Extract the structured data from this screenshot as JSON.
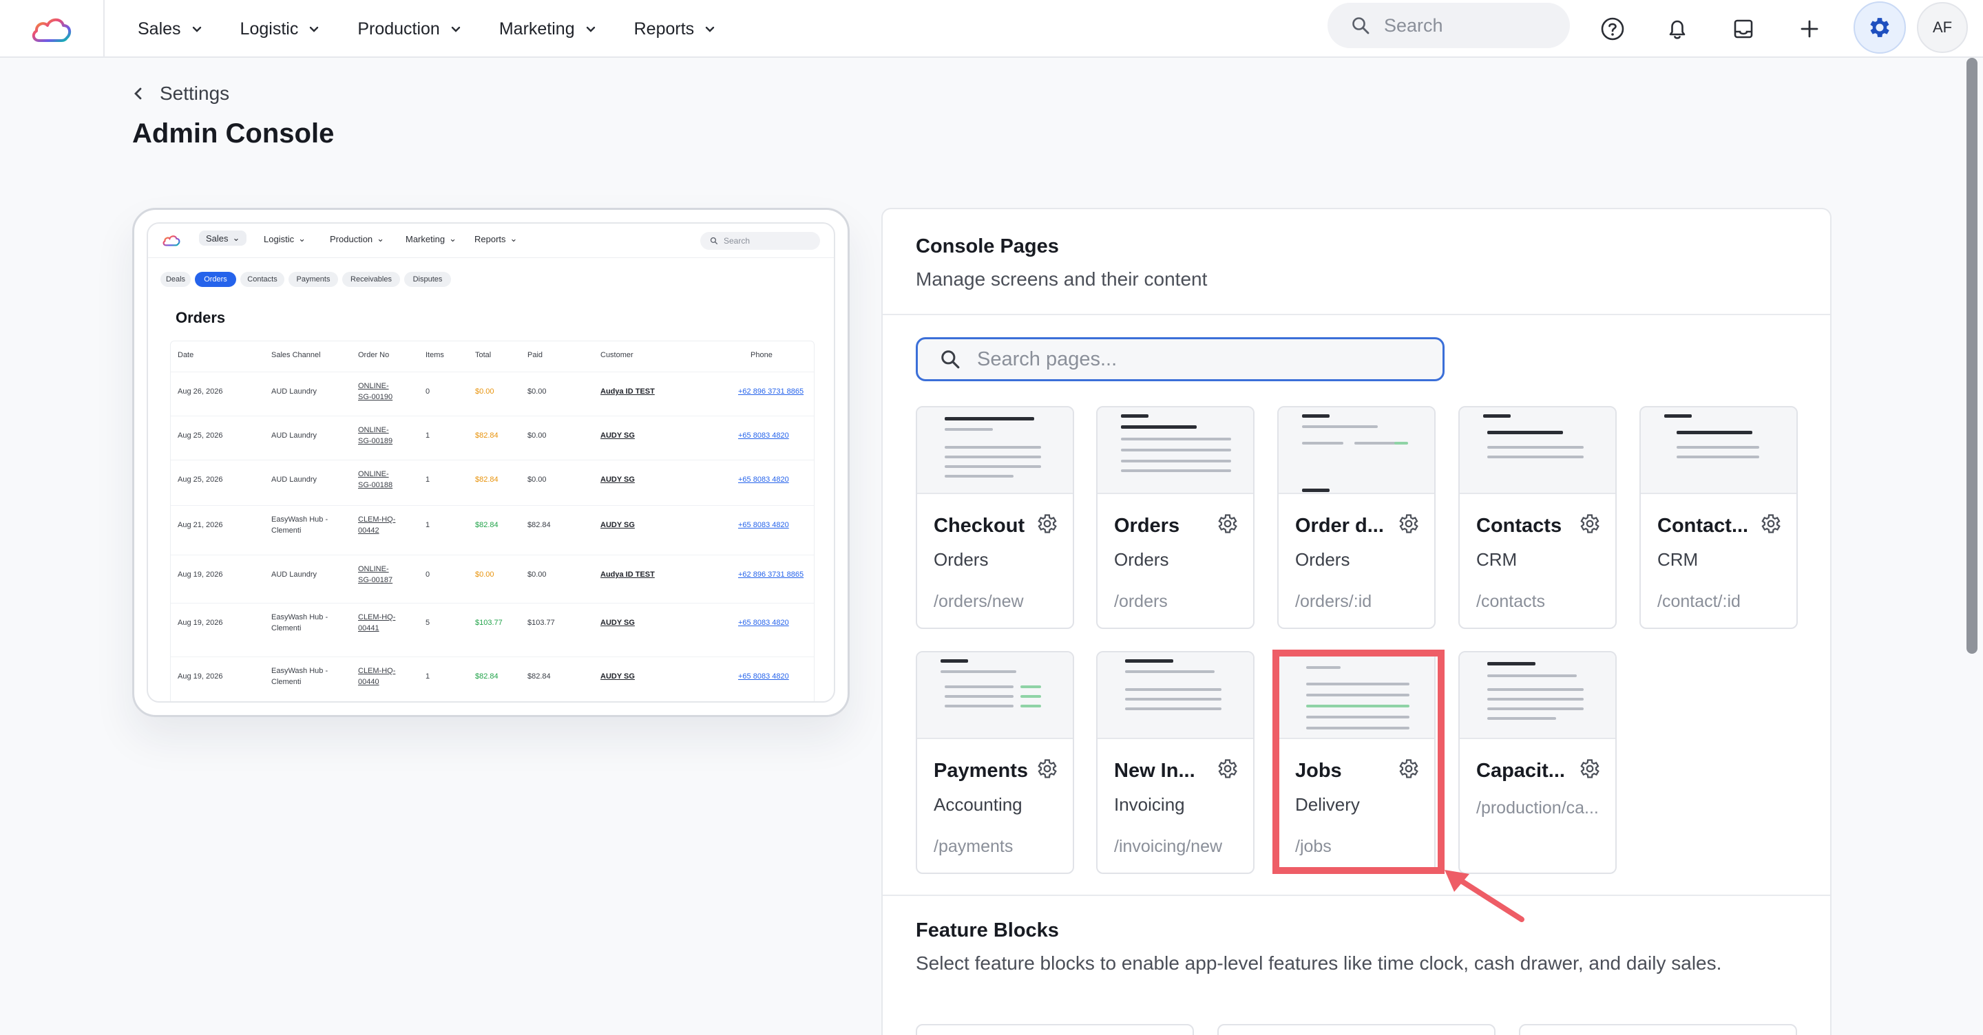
{
  "nav": {
    "menu": [
      {
        "label": "Sales"
      },
      {
        "label": "Logistic"
      },
      {
        "label": "Production"
      },
      {
        "label": "Marketing"
      },
      {
        "label": "Reports"
      }
    ],
    "search_placeholder": "Search",
    "avatar_initials": "AF"
  },
  "header": {
    "back_label": "Settings",
    "title": "Admin Console"
  },
  "preview": {
    "nav": [
      "Sales",
      "Logistic",
      "Production",
      "Marketing",
      "Reports"
    ],
    "search": "Search",
    "chips": [
      "Deals",
      "Orders",
      "Contacts",
      "Payments",
      "Receivables",
      "Disputes"
    ],
    "active_chip": "Orders",
    "title": "Orders",
    "columns": [
      "Date",
      "Sales Channel",
      "Order No",
      "Items",
      "Total",
      "Paid",
      "Customer",
      "Phone"
    ],
    "rows": [
      {
        "date": "Aug 26, 2026",
        "channel": "AUD Laundry",
        "order1": "ONLINE-",
        "order2": "SG-00190",
        "items": "0",
        "total": "$0.00",
        "paid": "$0.00",
        "customer": "Audya ID TEST",
        "phone": "+62 896 3731 8865"
      },
      {
        "date": "Aug 25, 2026",
        "channel": "AUD Laundry",
        "order1": "ONLINE-",
        "order2": "SG-00189",
        "items": "1",
        "total": "$82.84",
        "paid": "$0.00",
        "customer": "AUDY SG",
        "phone": "+65 8083 4820"
      },
      {
        "date": "Aug 25, 2026",
        "channel": "AUD Laundry",
        "order1": "ONLINE-",
        "order2": "SG-00188",
        "items": "1",
        "total": "$82.84",
        "paid": "$0.00",
        "customer": "AUDY SG",
        "phone": "+65 8083 4820"
      },
      {
        "date": "Aug 21, 2026",
        "channel": "EasyWash Hub -",
        "channel2": "Clementi",
        "order1": "CLEM-HQ-",
        "order2": "00442",
        "items": "1",
        "total": "$82.84",
        "paid": "$82.84",
        "customer": "AUDY SG",
        "phone": "+65 8083 4820"
      },
      {
        "date": "Aug 19, 2026",
        "channel": "AUD Laundry",
        "order1": "ONLINE-",
        "order2": "SG-00187",
        "items": "0",
        "total": "$0.00",
        "paid": "$0.00",
        "customer": "Audya ID TEST",
        "phone": "+62 896 3731 8865"
      },
      {
        "date": "Aug 19, 2026",
        "channel": "EasyWash Hub -",
        "channel2": "Clementi",
        "order1": "CLEM-HQ-",
        "order2": "00441",
        "items": "5",
        "total": "$103.77",
        "paid": "$103.77",
        "customer": "AUDY SG",
        "phone": "+65 8083 4820"
      },
      {
        "date": "Aug 19, 2026",
        "channel": "EasyWash Hub -",
        "channel2": "Clementi",
        "order1": "CLEM-HQ-",
        "order2": "00440",
        "items": "1",
        "total": "$82.84",
        "paid": "$82.84",
        "customer": "AUDY SG",
        "phone": "+65 8083 4820"
      }
    ]
  },
  "console": {
    "title": "Console Pages",
    "subtitle": "Manage screens and their content",
    "search_placeholder": "Search pages...",
    "pages": [
      {
        "name": "Checkout",
        "category": "Orders",
        "path": "/orders/new"
      },
      {
        "name": "Orders",
        "category": "Orders",
        "path": "/orders"
      },
      {
        "name": "Order d...",
        "category": "Orders",
        "path": "/orders/:id"
      },
      {
        "name": "Contacts",
        "category": "CRM",
        "path": "/contacts"
      },
      {
        "name": "Contact...",
        "category": "CRM",
        "path": "/contact/:id"
      },
      {
        "name": "Payments",
        "category": "Accounting",
        "path": "/payments"
      },
      {
        "name": "New In...",
        "category": "Invoicing",
        "path": "/invoicing/new"
      },
      {
        "name": "Jobs",
        "category": "Delivery",
        "path": "/jobs"
      },
      {
        "name": "Capacit...",
        "category": "",
        "path": "/production/ca..."
      }
    ]
  },
  "features": {
    "title": "Feature Blocks",
    "subtitle": "Select feature blocks to enable app-level features like time clock, cash drawer, and daily sales."
  },
  "colors": {
    "accent": "#2563eb",
    "highlight": "#ee5d66",
    "positive": "#22a34a",
    "warning": "#e8930c"
  }
}
